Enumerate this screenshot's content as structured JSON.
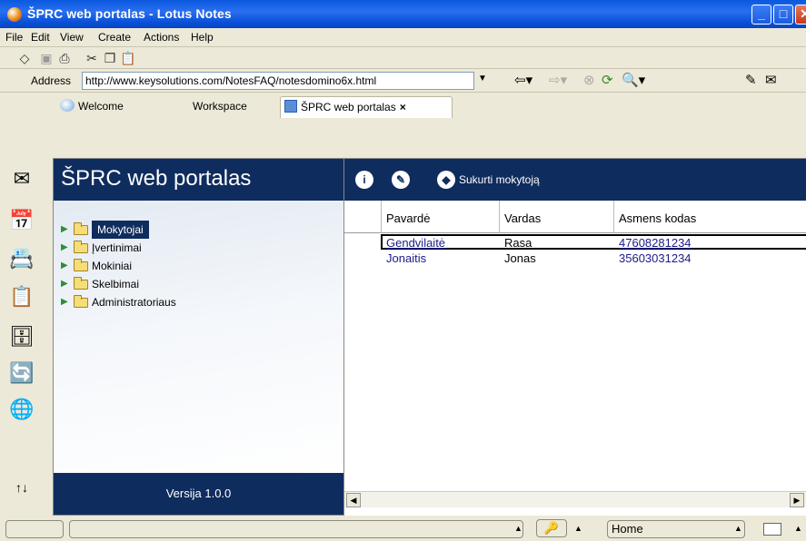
{
  "window": {
    "title": "ŠPRC web portalas - Lotus Notes",
    "min_label": "_",
    "max_label": "□",
    "close_label": "X"
  },
  "menu": [
    "File",
    "Edit",
    "View",
    "Create",
    "Actions",
    "Help"
  ],
  "address": {
    "label": "Address",
    "url": "http://www.keysolutions.com/NotesFAQ/notesdomino6x.html"
  },
  "tabs": [
    {
      "label": "Welcome"
    },
    {
      "label": "Workspace"
    },
    {
      "label": "ŠPRC web portalas",
      "close": "×"
    }
  ],
  "navigator": {
    "title": "ŠPRC web portalas",
    "items": [
      {
        "label": "Mokytojai",
        "selected": true
      },
      {
        "label": "Įvertinimai"
      },
      {
        "label": "Mokiniai"
      },
      {
        "label": "Skelbimai"
      },
      {
        "label": "Administratoriaus"
      }
    ],
    "footer": "Versija 1.0.0"
  },
  "view": {
    "action_label": "Sukurti mokytoją",
    "columns": [
      "Pavardė",
      "Vardas",
      "Asmens kodas"
    ],
    "rows": [
      {
        "pavarde": "Gendvilaitė",
        "vardas": "Rasa",
        "kodas": "47608281234"
      },
      {
        "pavarde": "Jonaitis",
        "vardas": "Jonas",
        "kodas": "35603031234"
      }
    ]
  },
  "status": {
    "location": "Home"
  }
}
